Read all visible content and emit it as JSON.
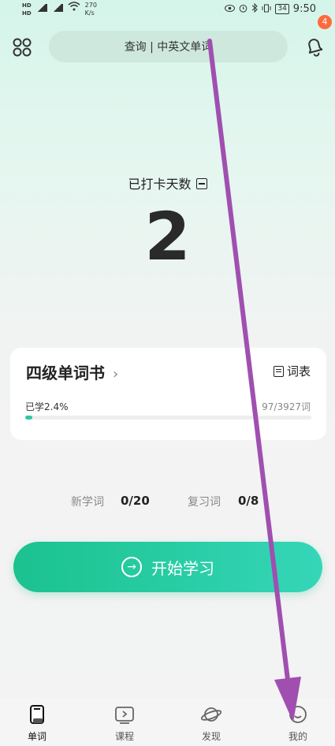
{
  "status_bar": {
    "net_speed": "270\nK/s",
    "net_speed_value": "270",
    "net_speed_unit": "K/s",
    "battery": "34",
    "time": "9:50"
  },
  "header": {
    "search_text": "查询 | 中英文单词",
    "notification_count": "4"
  },
  "checkin": {
    "label": "已打卡天数",
    "days": "2"
  },
  "book": {
    "title": "四级单词书",
    "wordlist_label": "词表",
    "learned_text": "已学2.4%",
    "progress_text": "97/3927词",
    "progress_fraction": 0.024
  },
  "stats": {
    "new_label": "新学词",
    "new_value": "0/20",
    "review_label": "复习词",
    "review_value": "0/8"
  },
  "start_button": {
    "label": "开始学习"
  },
  "nav": {
    "items": [
      {
        "label": "单词",
        "icon": "book-icon",
        "active": true
      },
      {
        "label": "课程",
        "icon": "play-icon",
        "active": false
      },
      {
        "label": "发现",
        "icon": "planet-icon",
        "active": false
      },
      {
        "label": "我的",
        "icon": "profile-icon",
        "active": false
      }
    ]
  },
  "colors": {
    "accent": "#1bc28e",
    "accent_end": "#35d6b8",
    "badge": "#ff6a3d",
    "annotation_arrow": "#a04fb0"
  }
}
